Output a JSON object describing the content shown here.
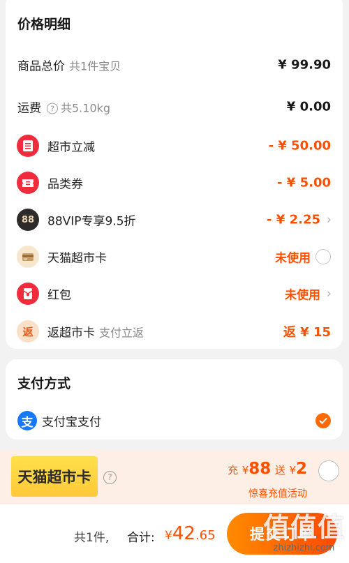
{
  "price_detail": {
    "title": "价格明细",
    "items": [
      {
        "label": "商品总价",
        "sub": "共1件宝贝",
        "value": "¥ 99.90"
      },
      {
        "label": "运费",
        "sub": "共5.10kg",
        "value": "¥ 0.00"
      },
      {
        "label": "超市立减",
        "value": "- ¥ 50.00",
        "icon": "jian-icon"
      },
      {
        "label": "品类券",
        "value": "- ¥ 5.00",
        "icon": "ticket-icon"
      },
      {
        "label": "88VIP专享9.5折",
        "value": "- ¥ 2.25",
        "icon": "88vip-icon",
        "icon_text": "88"
      },
      {
        "label": "天猫超市卡",
        "value": "未使用",
        "icon": "card-icon"
      },
      {
        "label": "红包",
        "value": "未使用",
        "icon": "red-packet-icon"
      },
      {
        "label": "返超市卡",
        "sub": "支付立返",
        "value": "返 ¥ 15",
        "icon": "fan-icon",
        "icon_text": "返"
      }
    ]
  },
  "payment": {
    "title": "支付方式",
    "method": "支付宝支付",
    "icon_text": "支"
  },
  "promo": {
    "badge": "天猫超市卡",
    "charge_prefix": "充",
    "currency": "¥",
    "charge_amount": "88",
    "gift_prefix": "送",
    "gift_amount": "2",
    "subtitle": "惊喜充值活动"
  },
  "bottom_bar": {
    "count": "共1件,",
    "total_label": "合计:",
    "currency": "¥",
    "total_int": "42",
    "total_dec": ".65",
    "submit_label": "提交订单"
  },
  "watermark": {
    "big": "值值值",
    "small": "zhizhizhi.com"
  },
  "colors": {
    "accent": "#ff5000",
    "button": "#ff6a00",
    "background": "#f2f2f2"
  }
}
